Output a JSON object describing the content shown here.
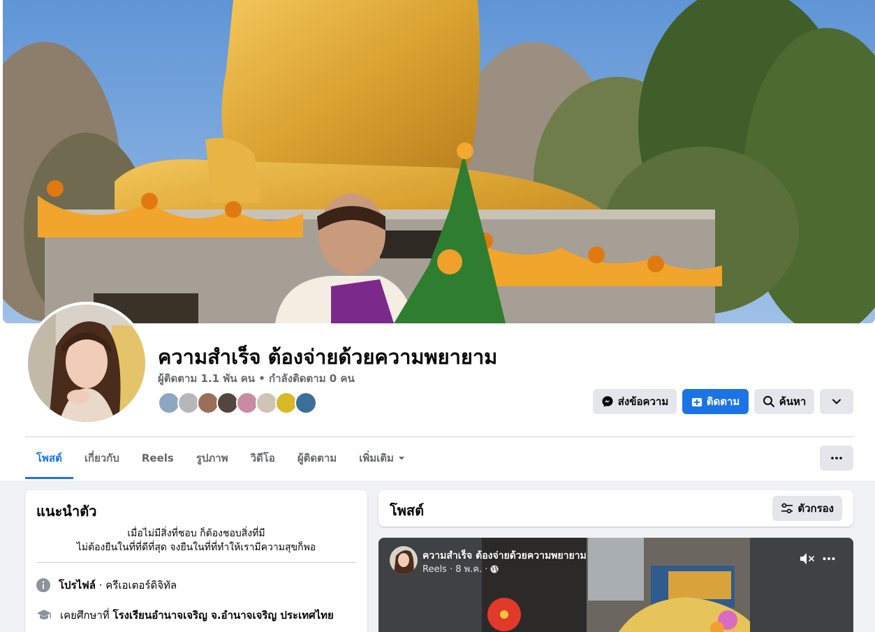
{
  "profile": {
    "name": "ความสำเร็จ ต้องจ่ายด้วยความพยายาม",
    "stats": "ผู้ติดตาม 1.1 พัน คน • กำลังติดตาม 0 คน"
  },
  "actions": {
    "message_label": "ส่งข้อความ",
    "follow_label": "ติดตาม",
    "search_label": "ค้นหา"
  },
  "tabs": [
    {
      "label": "โพสต์",
      "active": true
    },
    {
      "label": "เกี่ยวกับ",
      "active": false
    },
    {
      "label": "Reels",
      "active": false
    },
    {
      "label": "รูปภาพ",
      "active": false
    },
    {
      "label": "วิดีโอ",
      "active": false
    },
    {
      "label": "ผู้ติดตาม",
      "active": false
    },
    {
      "label": "เพิ่มเติม",
      "active": false
    }
  ],
  "intro": {
    "title": "แนะนำตัว",
    "bio_line1": "เมื่อไม่มีสิ่งที่ชอบ ก็ต้องชอบสิ่งที่มี",
    "bio_line2": "ไม่ต้องยืนในที่ที่ดีที่สุด จงยืนในที่ที่ทำให้เรามีความสุขก็พอ",
    "profile_label": "โปรไฟล์",
    "profile_value": " · ครีเอเตอร์ดิจิทัล",
    "education_prefix": "เคยศึกษาที่ ",
    "education_value": "โรงเรียนอำนาจเจริญ จ.อำนาจเจริญ ประเทศไทย"
  },
  "posts": {
    "title": "โพสต์",
    "filter_label": "ตัวกรอง"
  },
  "reel_post": {
    "author": "ความสำเร็จ ต้องจ่ายด้วยความพยายาม",
    "meta": "Reels · 8 พ.ค. ·"
  },
  "colors": {
    "accent": "#1b74e4",
    "page_bg": "#f0f2f5",
    "secondary_text": "#65676b"
  },
  "icons": {
    "message": "messenger-icon",
    "follow": "follow-plus-icon",
    "search": "search-icon",
    "more": "chevron-down-icon",
    "tab_more": "ellipsis-icon",
    "filter": "filter-sliders-icon",
    "info": "info-icon",
    "education": "graduation-cap-icon",
    "mute": "speaker-muted-icon",
    "globe": "globe-icon"
  }
}
